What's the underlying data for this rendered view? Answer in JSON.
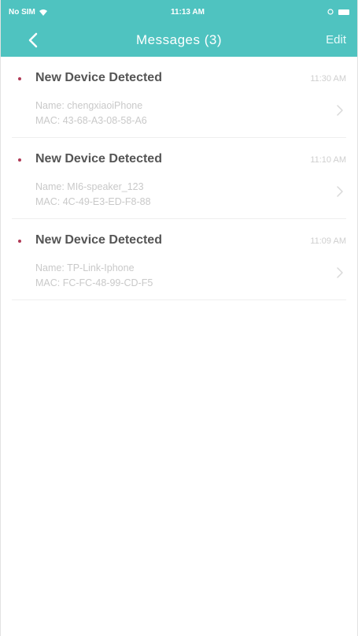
{
  "status_bar": {
    "carrier": "No SIM",
    "time": "11:13 AM"
  },
  "header": {
    "title": "Messages (3)",
    "edit_label": "Edit",
    "accent_color": "#4fc3c0"
  },
  "messages": [
    {
      "title": "New Device Detected",
      "time": "11:30 AM",
      "name": "Name: chengxiaoiPhone",
      "mac": "MAC: 43-68-A3-08-58-A6"
    },
    {
      "title": "New Device Detected",
      "time": "11:10 AM",
      "name": "Name: MI6-speaker_123",
      "mac": "MAC: 4C-49-E3-ED-F8-88"
    },
    {
      "title": "New Device Detected",
      "time": "11:09 AM",
      "name": "Name: TP-Link-Iphone",
      "mac": "MAC: FC-FC-48-99-CD-F5"
    }
  ],
  "icons": {
    "back": "chevron-left-icon",
    "row_arrow": "chevron-right-icon",
    "wifi": "wifi-icon",
    "battery": "battery-icon",
    "unread": "unread-dot-icon"
  }
}
